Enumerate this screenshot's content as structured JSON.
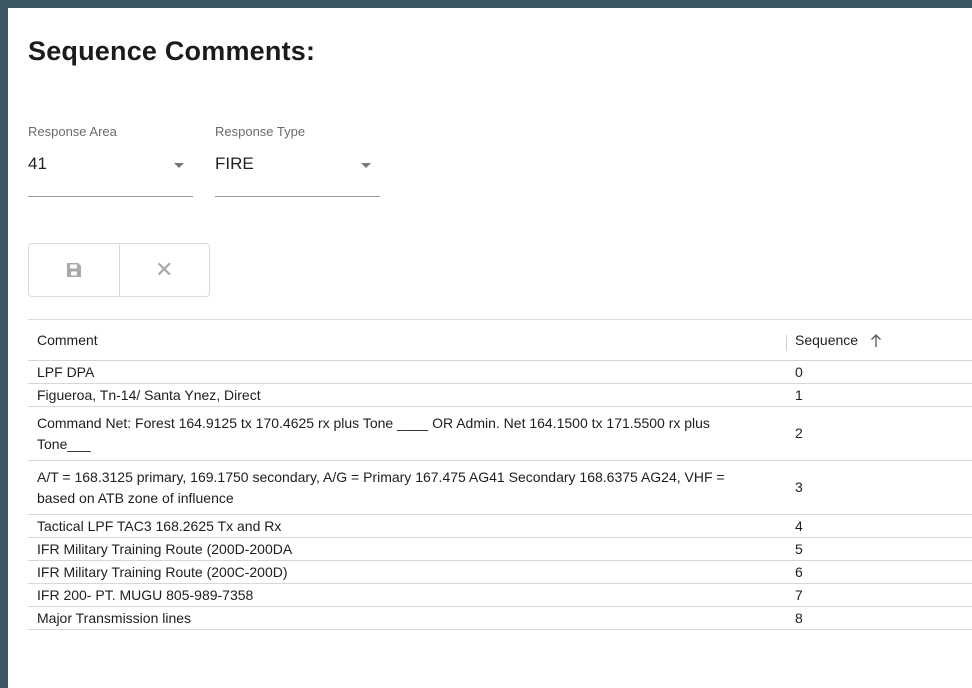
{
  "page": {
    "title": "Sequence Comments:"
  },
  "filters": {
    "response_area": {
      "label": "Response Area",
      "value": "41"
    },
    "response_type": {
      "label": "Response Type",
      "value": "FIRE"
    }
  },
  "toolbar": {
    "save_icon": "save-icon",
    "cancel_icon": "close-icon",
    "cancel_glyph": "✕"
  },
  "grid": {
    "columns": [
      {
        "label": "Comment"
      },
      {
        "label": "Sequence",
        "sort": "ascending"
      }
    ],
    "rows": [
      {
        "comment": "LPF DPA",
        "sequence": "0"
      },
      {
        "comment": "Figueroa, Tn-14/ Santa Ynez, Direct",
        "sequence": "1"
      },
      {
        "comment": "Command Net: Forest 164.9125 tx 170.4625 rx plus Tone ____ OR Admin. Net 164.1500 tx 171.5500 rx plus Tone___",
        "sequence": "2"
      },
      {
        "comment": "A/T = 168.3125 primary, 169.1750 secondary, A/G = Primary 167.475 AG41 Secondary 168.6375 AG24, VHF = based on ATB zone of influence",
        "sequence": "3"
      },
      {
        "comment": "Tactical LPF TAC3 168.2625 Tx and Rx",
        "sequence": "4"
      },
      {
        "comment": "IFR Military Training Route (200D-200DA",
        "sequence": "5"
      },
      {
        "comment": "IFR Military Training Route (200C-200D)",
        "sequence": "6"
      },
      {
        "comment": "IFR 200- PT. MUGU 805-989-7358",
        "sequence": "7"
      },
      {
        "comment": "Major Transmission lines",
        "sequence": "8"
      }
    ]
  },
  "colors": {
    "frame": "#3d5663",
    "icon_gray": "#a8a8a8"
  }
}
